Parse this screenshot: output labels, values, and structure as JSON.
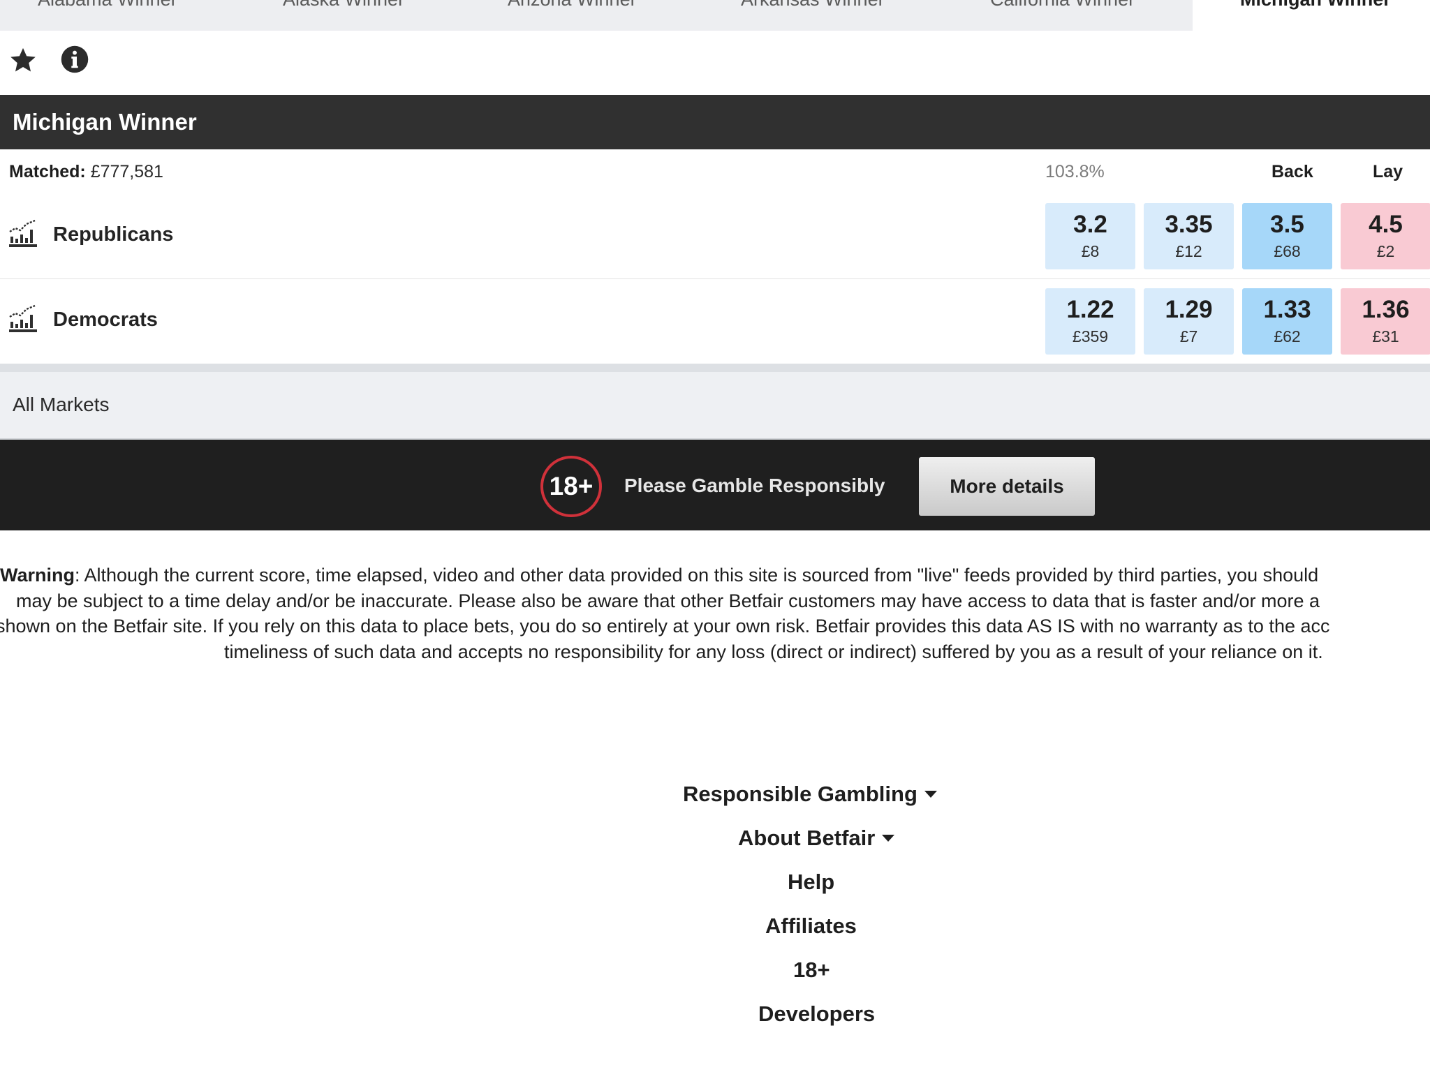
{
  "tabs": [
    "Alabama Winner",
    "Alaska Winner",
    "Arizona Winner",
    "Arkansas Winner",
    "California Winner",
    "Michigan Winner"
  ],
  "active_tab": "Michigan Winner",
  "icons": {
    "favourite": "star-icon",
    "info": "info-icon",
    "chart": "chart-icon"
  },
  "market": {
    "title": "Michigan Winner",
    "matched_label": "Matched:",
    "matched_value": "£777,581",
    "book_percentage": "103.8%",
    "back_label": "Back",
    "lay_label": "Lay"
  },
  "runners": [
    {
      "name": "Republicans",
      "prices": [
        {
          "odds": "3.2",
          "amount": "£8"
        },
        {
          "odds": "3.35",
          "amount": "£12"
        },
        {
          "odds": "3.5",
          "amount": "£68"
        },
        {
          "odds": "4.5",
          "amount": "£2"
        }
      ]
    },
    {
      "name": "Democrats",
      "prices": [
        {
          "odds": "1.22",
          "amount": "£359"
        },
        {
          "odds": "1.29",
          "amount": "£7"
        },
        {
          "odds": "1.33",
          "amount": "£62"
        },
        {
          "odds": "1.36",
          "amount": "£31"
        }
      ]
    }
  ],
  "all_markets": "All Markets",
  "banner": {
    "age_badge": "18+",
    "text": "Please Gamble Responsibly",
    "button": "More details"
  },
  "warning": {
    "label": "Warning",
    "lines": [
      ": Although the current score, time elapsed, video and other data provided on this site is sourced from \"live\" feeds provided by third parties, you should",
      "may be subject to a time delay and/or be inaccurate.  Please also be aware that other Betfair customers may have access to data that is faster and/or more a",
      "shown on the Betfair site. If you rely on this data to place bets, you do so entirely at your own risk. Betfair provides this data AS IS with no warranty as to the acc",
      "timeliness of such data and accepts no responsibility for any loss (direct or indirect) suffered by you as a result of your reliance on it."
    ]
  },
  "footer": {
    "responsible_gambling": "Responsible Gambling",
    "about": "About Betfair",
    "help": "Help",
    "affiliates": "Affiliates",
    "age": "18+",
    "developers": "Developers"
  },
  "colors": {
    "header_bg": "#303030",
    "back_light": "#d8ebfb",
    "back_best": "#a6d7f9",
    "lay": "#f9cad3",
    "banner_bg": "#1f1f1f",
    "badge_ring": "#d0313a"
  }
}
